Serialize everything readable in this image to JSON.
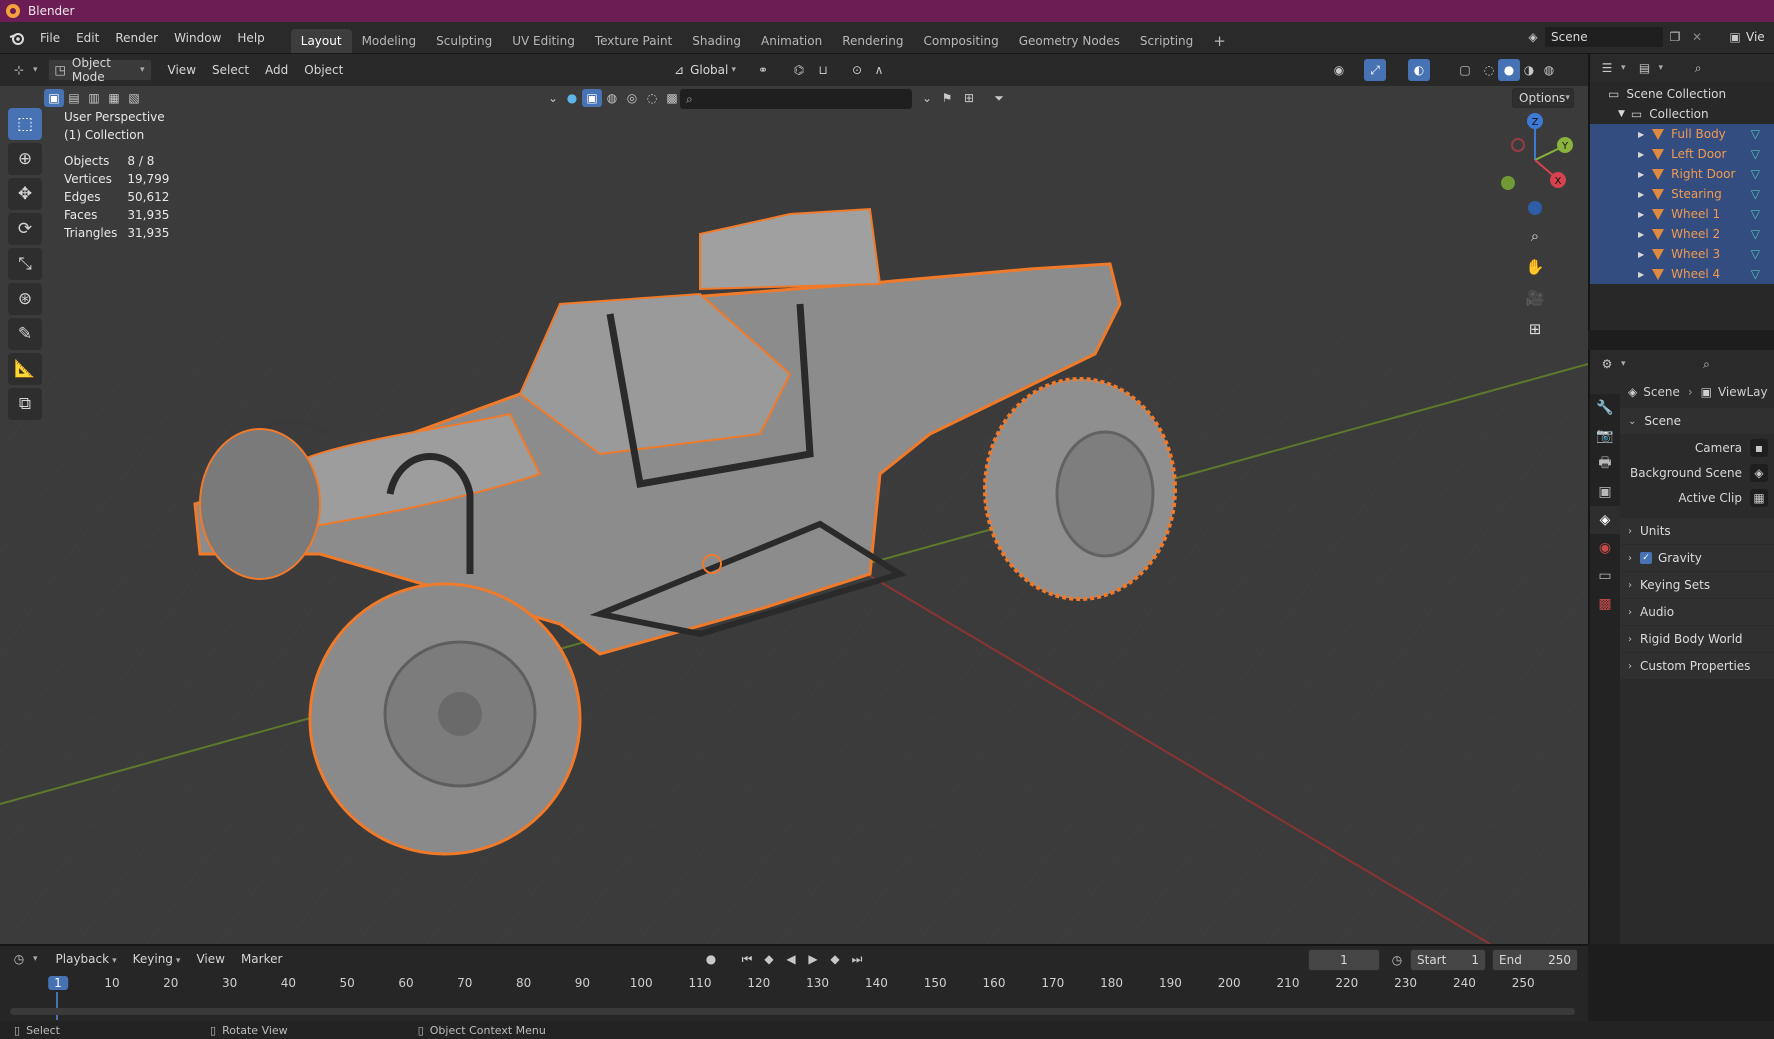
{
  "window": {
    "title": "Blender"
  },
  "menu": [
    "File",
    "Edit",
    "Render",
    "Window",
    "Help"
  ],
  "workspaces": [
    "Layout",
    "Modeling",
    "Sculpting",
    "UV Editing",
    "Texture Paint",
    "Shading",
    "Animation",
    "Rendering",
    "Compositing",
    "Geometry Nodes",
    "Scripting"
  ],
  "workspace_active": "Layout",
  "scene_field": "Scene",
  "viewlayer_field": "Vie",
  "viewport": {
    "mode": "Object Mode",
    "menus": [
      "View",
      "Select",
      "Add",
      "Object"
    ],
    "orientation": "Global",
    "options_label": "Options",
    "overlay_title": "User Perspective",
    "overlay_collection": "(1) Collection",
    "stats": [
      {
        "label": "Objects",
        "value": "8 / 8"
      },
      {
        "label": "Vertices",
        "value": "19,799"
      },
      {
        "label": "Edges",
        "value": "50,612"
      },
      {
        "label": "Faces",
        "value": "31,935"
      },
      {
        "label": "Triangles",
        "value": "31,935"
      }
    ],
    "gizmo_axes": {
      "z": "Z",
      "y": "Y",
      "x": "X"
    }
  },
  "outliner": {
    "scene_collection": "Scene Collection",
    "collection": "Collection",
    "items": [
      "Full Body",
      "Left Door",
      "Right Door",
      "Stearing",
      "Wheel 1",
      "Wheel 2",
      "Wheel 3",
      "Wheel 4"
    ]
  },
  "properties": {
    "breadcrumb_scene": "Scene",
    "breadcrumb_viewlayer": "ViewLay",
    "section": "Scene",
    "fields": [
      {
        "label": "Camera"
      },
      {
        "label": "Background Scene"
      },
      {
        "label": "Active Clip"
      }
    ],
    "panels": [
      "Units",
      "Gravity",
      "Keying Sets",
      "Audio",
      "Rigid Body World",
      "Custom Properties"
    ]
  },
  "timeline": {
    "menus": [
      "Playback",
      "Keying",
      "View",
      "Marker"
    ],
    "current_frame": "1",
    "start_label": "Start",
    "start_value": "1",
    "end_label": "End",
    "end_value": "250",
    "ticks": [
      "1",
      "10",
      "20",
      "30",
      "40",
      "50",
      "60",
      "70",
      "80",
      "90",
      "100",
      "110",
      "120",
      "130",
      "140",
      "150",
      "160",
      "170",
      "180",
      "190",
      "200",
      "210",
      "220",
      "230",
      "240",
      "250"
    ]
  },
  "statusbar": {
    "items": [
      "Select",
      "Rotate View",
      "Object Context Menu"
    ]
  },
  "colors": {
    "accent": "#4772b3",
    "titlebar": "#6b1d54",
    "selection_outline": "#f07a2a",
    "grid": "#3b3b3b"
  }
}
